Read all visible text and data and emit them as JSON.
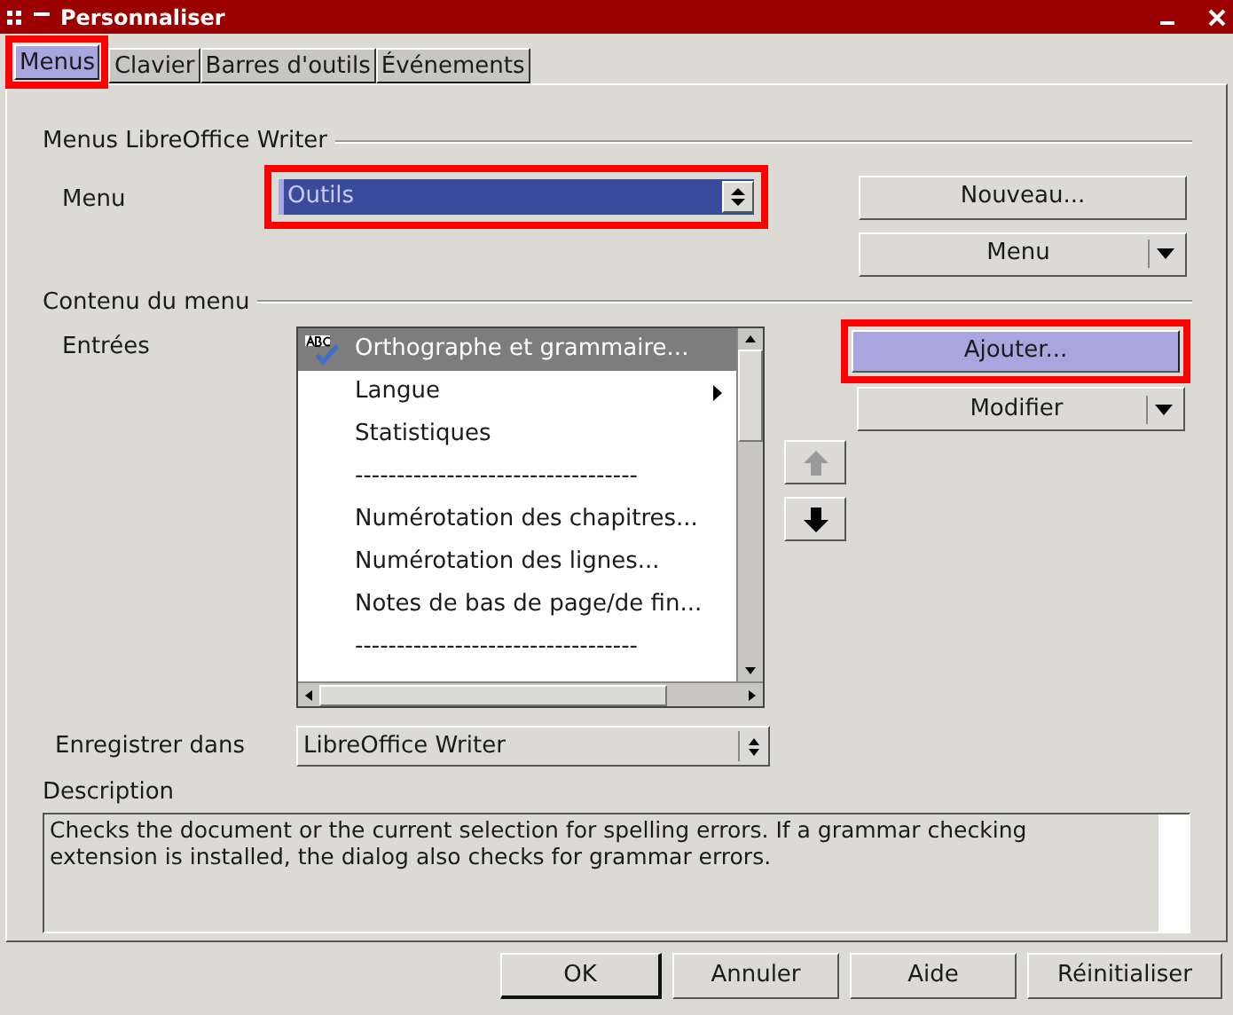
{
  "window": {
    "title": "Personnaliser"
  },
  "tabs": [
    {
      "label": "Menus",
      "selected": true,
      "annotated": true
    },
    {
      "label": "Clavier",
      "selected": false,
      "annotated": false
    },
    {
      "label": "Barres d'outils",
      "selected": false,
      "annotated": false
    },
    {
      "label": "Événements",
      "selected": false,
      "annotated": false
    }
  ],
  "menus_section": {
    "heading": "Menus LibreOffice Writer",
    "menu_label": {
      "text": "Menu"
    },
    "menu_select": {
      "value": "Outils",
      "annotated": true
    },
    "new_button": {
      "label": "Nouveau..."
    },
    "menu_button": {
      "label": "Menu"
    }
  },
  "contents_section": {
    "heading": "Contenu du menu",
    "entries_label": "Entrées",
    "entries": [
      {
        "kind": "icon_item",
        "label": "Orthographe et grammaire...",
        "selected": true,
        "submenu": false
      },
      {
        "kind": "item",
        "label": "Langue",
        "selected": false,
        "submenu": true
      },
      {
        "kind": "item",
        "label": "Statistiques",
        "selected": false,
        "submenu": false
      },
      {
        "kind": "separator",
        "label": "----------------------------------",
        "selected": false,
        "submenu": false
      },
      {
        "kind": "item",
        "label": "Numérotation des chapitres...",
        "selected": false,
        "submenu": false
      },
      {
        "kind": "item",
        "label": "Numérotation des lignes...",
        "selected": false,
        "submenu": false
      },
      {
        "kind": "item",
        "label": "Notes de bas de page/de fin...",
        "selected": false,
        "submenu": false
      },
      {
        "kind": "separator",
        "label": "----------------------------------",
        "selected": false,
        "submenu": false
      }
    ],
    "move_up": {
      "disabled": true
    },
    "move_down": {
      "disabled": false
    },
    "add_button": {
      "label": "Ajouter...",
      "annotated": true
    },
    "modify_button": {
      "label": "Modifier"
    }
  },
  "save_in": {
    "label": "Enregistrer dans",
    "value": "LibreOffice Writer"
  },
  "description": {
    "label": "Description",
    "text": "Checks the document or the current selection for spelling errors. If a grammar checking extension is installed, the dialog also checks for grammar errors."
  },
  "buttons": [
    {
      "label": "OK",
      "default": true
    },
    {
      "label": "Annuler",
      "default": false
    },
    {
      "label": "Aide",
      "default": false
    },
    {
      "label": "Réinitialiser",
      "default": false
    }
  ]
}
